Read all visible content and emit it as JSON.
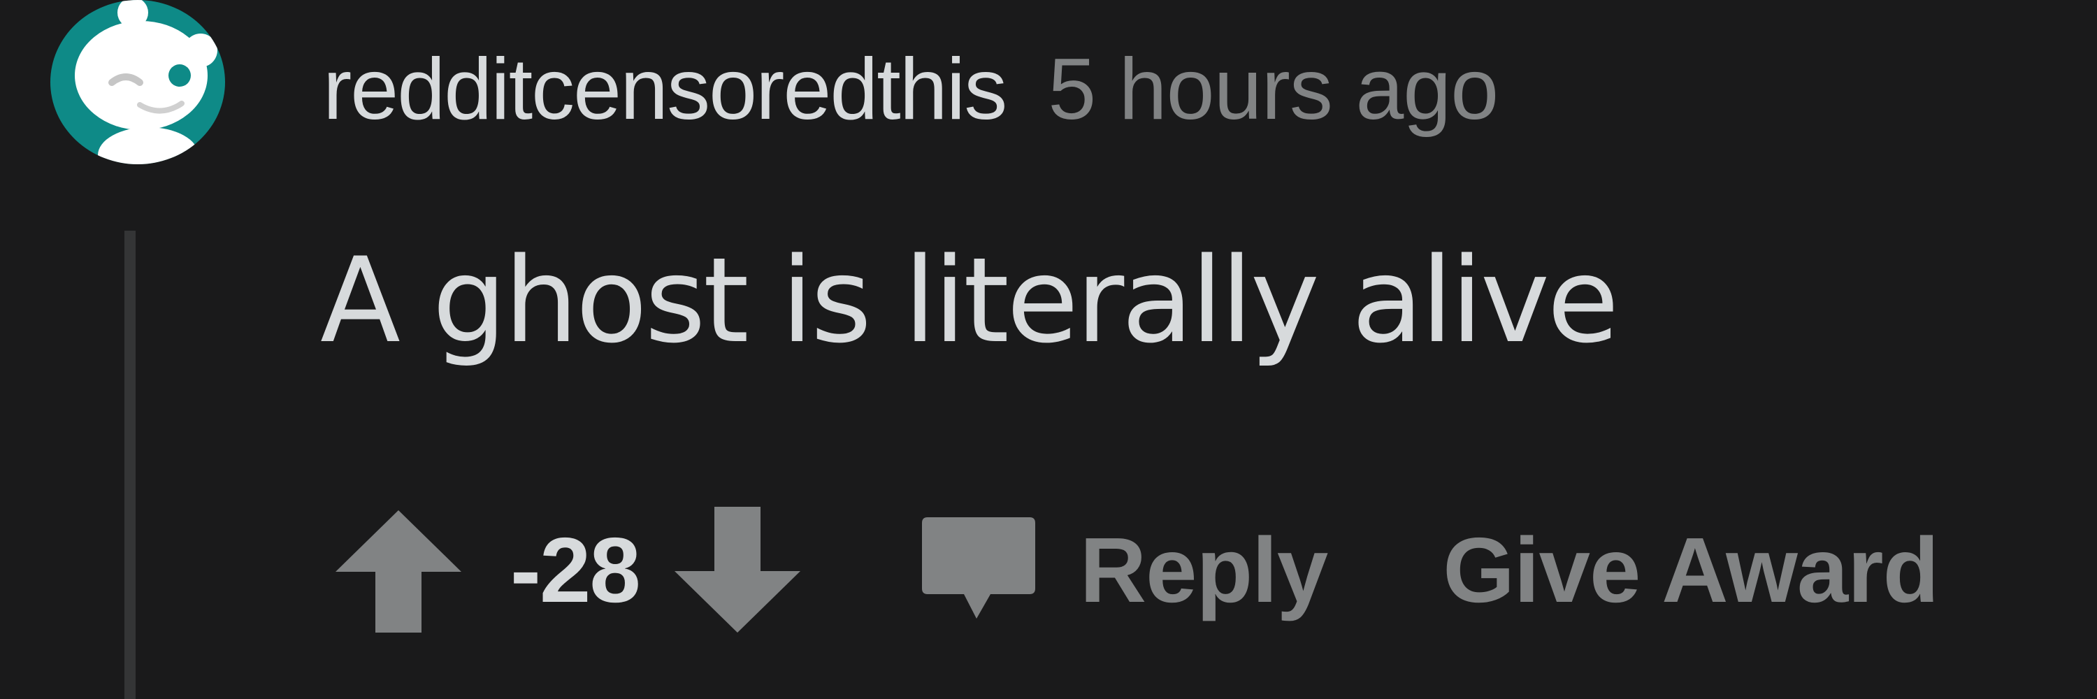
{
  "comment": {
    "username": "redditcensoredthis",
    "timestamp": "5 hours ago",
    "body": "A ghost is literally alive",
    "score": "-28",
    "icons": {
      "avatar": "snoo-avatar-icon",
      "upvote": "upvote-arrow-icon",
      "downvote": "downvote-arrow-icon",
      "reply": "comment-bubble-icon"
    }
  },
  "actions": {
    "reply_label": "Reply",
    "award_label": "Give Award"
  },
  "colors": {
    "background": "#1a1a1b",
    "text_primary": "#d7dadc",
    "text_secondary": "#818384",
    "avatar_bg": "#0e8a87",
    "thread_line": "#343536"
  }
}
